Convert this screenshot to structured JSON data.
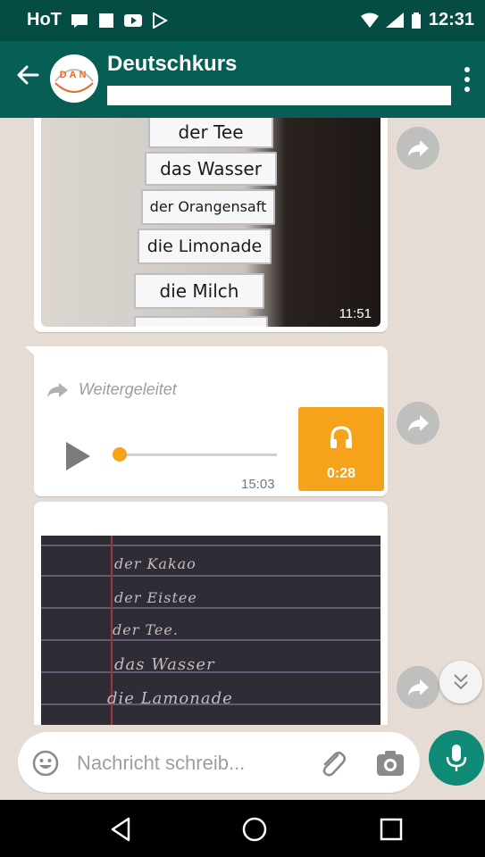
{
  "status_bar": {
    "carrier": "HoT",
    "time": "12:31"
  },
  "header": {
    "title": "Deutschkurs",
    "avatar_text": "DAN"
  },
  "messages": {
    "image1": {
      "time": "11:51",
      "cards": [
        "der Tee",
        "das Wasser",
        "der Orangensaft",
        "die Limonade",
        "die Milch"
      ]
    },
    "voice": {
      "forwarded_label": "Weitergeleitet",
      "time": "15:03",
      "duration": "0:28",
      "progress": 0.0
    },
    "image2": {
      "lines": [
        "der Kakao",
        "der Eistee",
        "der Tee.",
        "das Wasser",
        "die Lamonade"
      ]
    }
  },
  "composer": {
    "placeholder": "Nachricht schreib..."
  },
  "colors": {
    "header": "#075e54",
    "status_bar": "#054d44",
    "audio_accent": "#f7a21b",
    "mic_button": "#0e8a76"
  },
  "icons": {
    "back": "arrow-left-icon",
    "more": "more-vert-icon",
    "forward": "forward-icon",
    "play": "play-icon",
    "headphones": "headphones-icon",
    "emoji": "emoji-icon",
    "attach": "paperclip-icon",
    "camera": "camera-icon",
    "mic": "mic-icon",
    "scroll_down": "double-chevron-down-icon"
  }
}
